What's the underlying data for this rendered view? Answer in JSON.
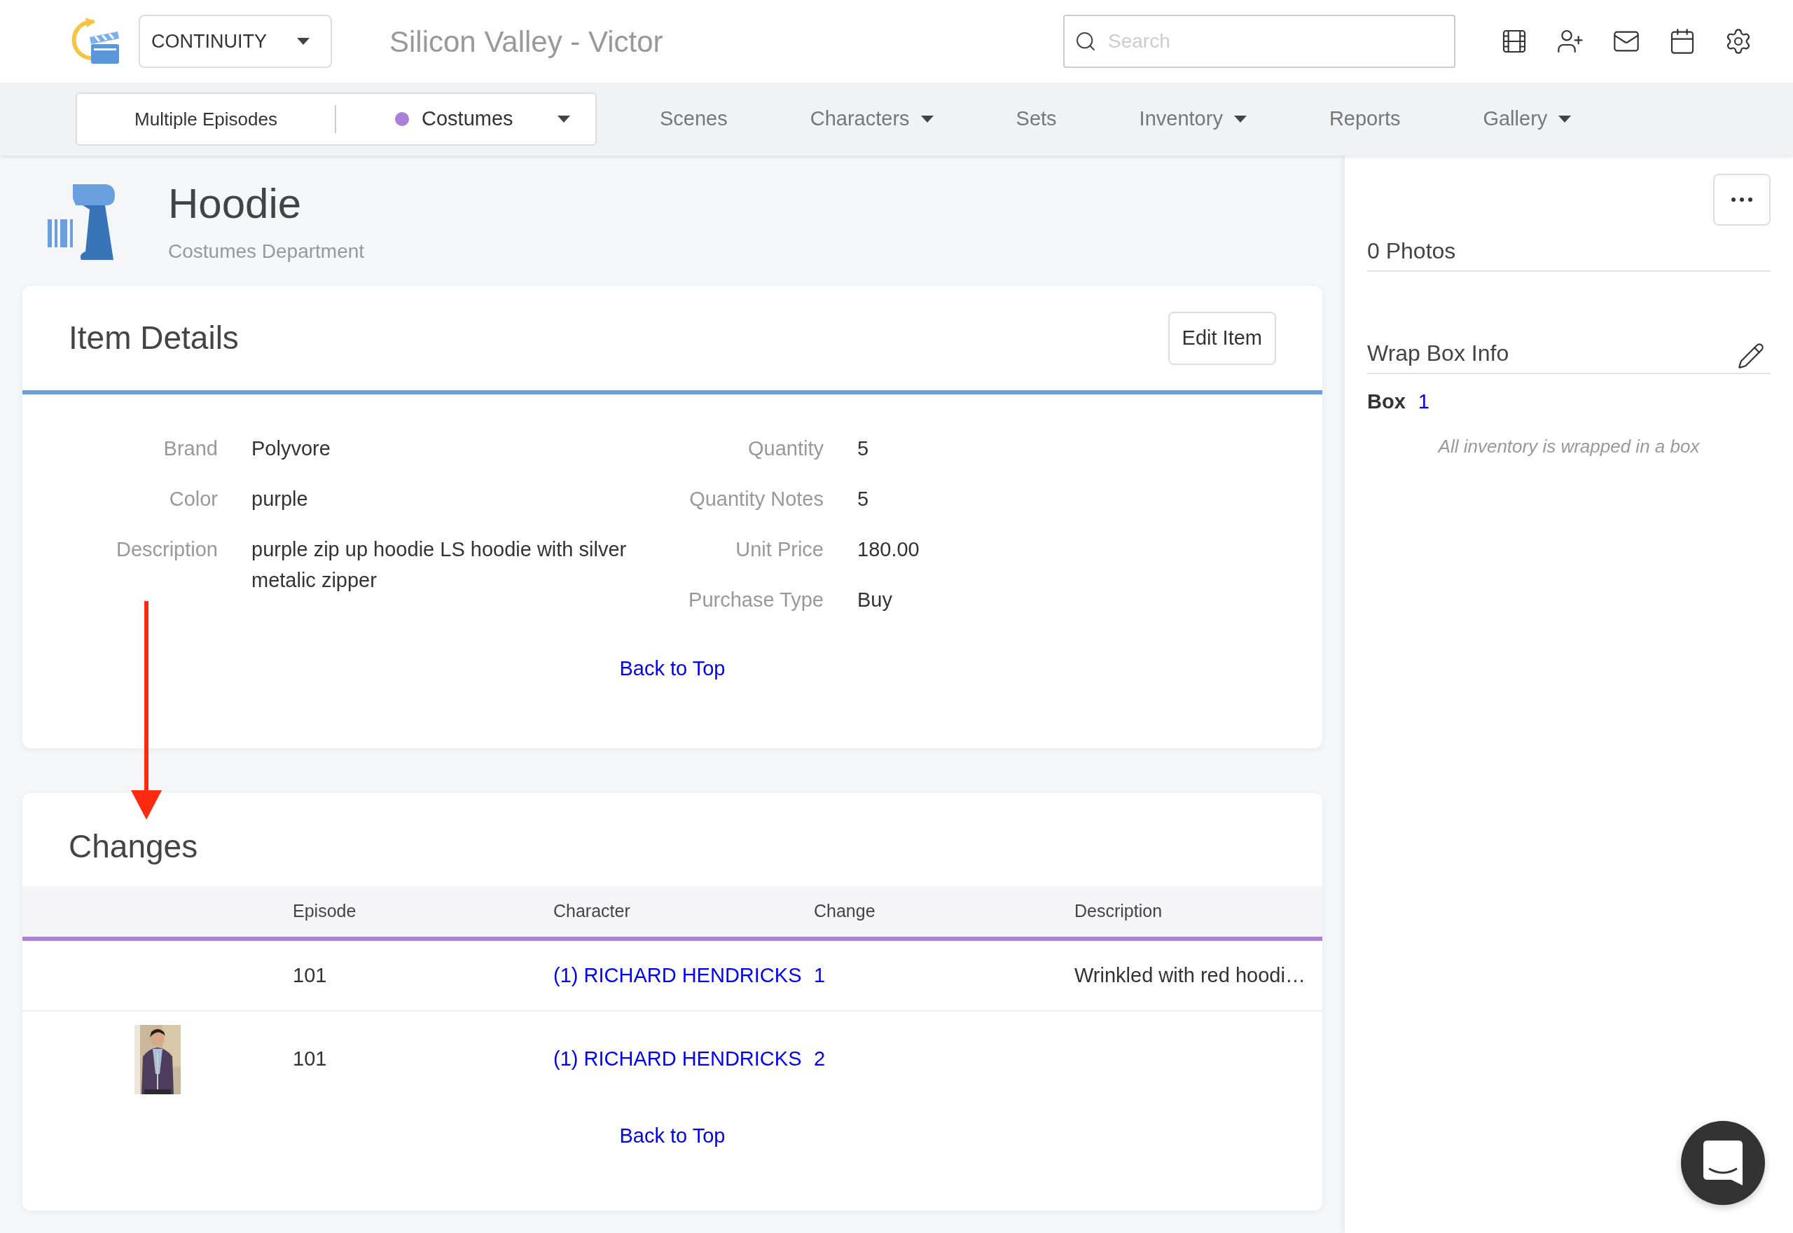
{
  "header": {
    "app_switcher": "CONTINUITY",
    "project_title": "Silicon Valley - Victor",
    "search": {
      "placeholder": "Search"
    }
  },
  "nav": {
    "episode_filter": "Multiple Episodes",
    "department": {
      "label": "Costumes",
      "color": "#a97fd8"
    },
    "items": [
      {
        "label": "Scenes",
        "dropdown": false
      },
      {
        "label": "Characters",
        "dropdown": true
      },
      {
        "label": "Sets",
        "dropdown": false
      },
      {
        "label": "Inventory",
        "dropdown": true
      },
      {
        "label": "Reports",
        "dropdown": false
      },
      {
        "label": "Gallery",
        "dropdown": true
      }
    ]
  },
  "item": {
    "title": "Hoodie",
    "subtitle": "Costumes Department"
  },
  "details": {
    "title": "Item Details",
    "edit_button": "Edit Item",
    "left": [
      {
        "label": "Brand",
        "value": "Polyvore"
      },
      {
        "label": "Color",
        "value": "purple"
      },
      {
        "label": "Description",
        "value": "purple zip up hoodie LS hoodie with silver metalic zipper"
      }
    ],
    "right": [
      {
        "label": "Quantity",
        "value": "5"
      },
      {
        "label": "Quantity Notes",
        "value": "5"
      },
      {
        "label": "Unit Price",
        "value": "180.00"
      },
      {
        "label": "Purchase Type",
        "value": "Buy"
      }
    ],
    "back_to_top": "Back to Top"
  },
  "changes": {
    "title": "Changes",
    "columns": [
      "Episode",
      "Character",
      "Change",
      "Description"
    ],
    "rows": [
      {
        "episode": "101",
        "character": "(1) RICHARD HENDRICKS",
        "change": "1",
        "description": "Wrinkled with red hoodi…"
      },
      {
        "episode": "101",
        "character": "(1) RICHARD HENDRICKS",
        "change": "2"
      }
    ],
    "back_to_top": "Back to Top"
  },
  "sidebar": {
    "photos_title": "0 Photos",
    "wrap_box_title": "Wrap Box Info",
    "box_label": "Box",
    "box_value": "1",
    "note": "All inventory is wrapped in a box"
  }
}
